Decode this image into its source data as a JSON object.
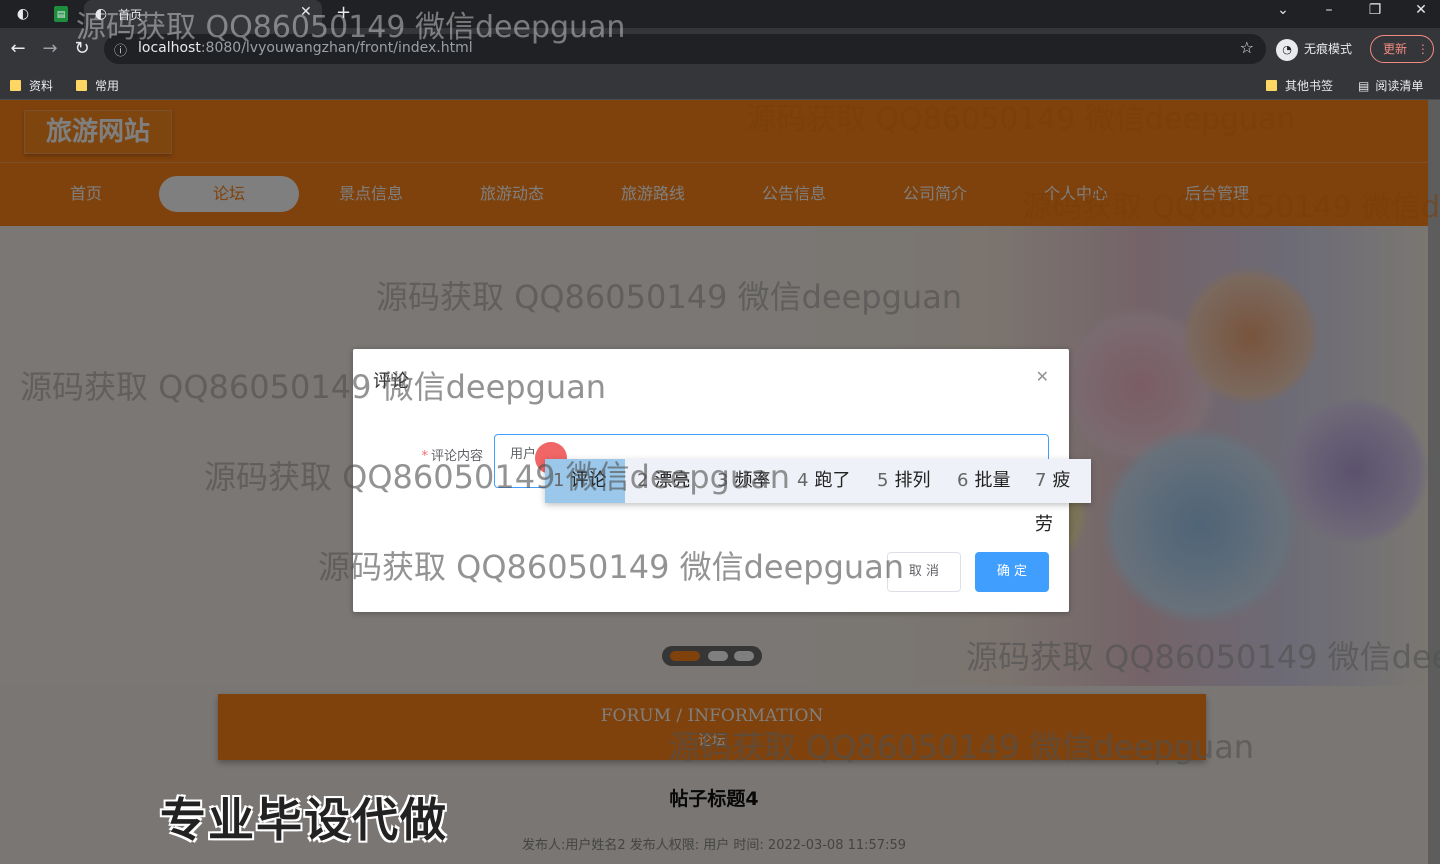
{
  "browser": {
    "tab_title": "首页",
    "url_host": "localhost",
    "url_path": ":8080/lvyouwangzhan/front/index.html",
    "incognito_label": "无痕模式",
    "update_label": "更新",
    "bookmarks": [
      "资料",
      "常用"
    ],
    "bookmarks_right": [
      "其他书签",
      "阅读清单"
    ]
  },
  "site": {
    "logo": "旅游网站",
    "nav": [
      "首页",
      "论坛",
      "景点信息",
      "旅游动态",
      "旅游路线",
      "公告信息",
      "公司简介",
      "个人中心",
      "后台管理"
    ],
    "active_nav": "论坛"
  },
  "section": {
    "title_en": "FORUM / INFORMATION",
    "title_cn": "论坛"
  },
  "post": {
    "title": "帖子标题4",
    "meta": "发布人:用户姓名2   发布人权限: 用户   时间: 2022-03-08 11:57:59"
  },
  "slogan": "专业毕设代做",
  "dialog": {
    "title": "评论",
    "label": "评论内容",
    "textarea_value": "用户",
    "cancel": "取 消",
    "confirm": "确 定"
  },
  "ime": {
    "candidates": [
      {
        "num": "1",
        "word": "评论"
      },
      {
        "num": "2",
        "word": "漂亮"
      },
      {
        "num": "3",
        "word": "频率"
      },
      {
        "num": "4",
        "word": "跑了"
      },
      {
        "num": "5",
        "word": "排列"
      },
      {
        "num": "6",
        "word": "批量"
      },
      {
        "num": "7",
        "word": "疲劳"
      }
    ]
  },
  "watermark": "源码获取 QQ86050149 微信deepguan",
  "colors": {
    "brand_orange": "#ff8418",
    "primary_blue": "#409eff"
  }
}
